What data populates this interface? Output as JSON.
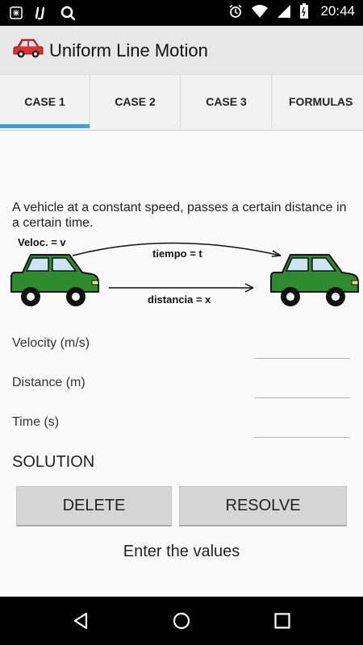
{
  "status_bar": {
    "time": "20:44"
  },
  "app": {
    "title": "Uniform Line Motion"
  },
  "tabs": [
    {
      "label": "CASE 1",
      "selected": true
    },
    {
      "label": "CASE 2",
      "selected": false
    },
    {
      "label": "CASE 3",
      "selected": false
    },
    {
      "label": "FORMULAS",
      "selected": false
    }
  ],
  "description": "A vehicle at a constant speed, passes a certain distance in a certain time.",
  "diagram": {
    "velocity_label": "Veloc. = v",
    "time_label": "tiempo = t",
    "distance_label": "distancia = x"
  },
  "fields": {
    "velocity": {
      "label": "Velocity (m/s)",
      "value": ""
    },
    "distance": {
      "label": "Distance (m)",
      "value": ""
    },
    "time": {
      "label": "Time (s)",
      "value": ""
    }
  },
  "solution_label": "SOLUTION",
  "buttons": {
    "delete": "DELETE",
    "resolve": "RESOLVE"
  },
  "message": "Enter the values",
  "colors": {
    "accent": "#3aa3dc",
    "car": "#2e8b2e",
    "app_bar": "#e8e8e8"
  }
}
